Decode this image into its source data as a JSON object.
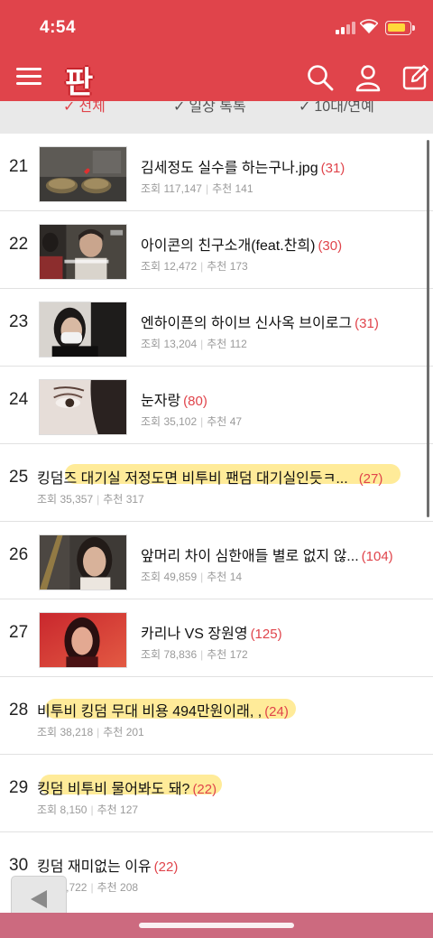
{
  "status_bar": {
    "time": "4:54"
  },
  "app_bar": {
    "logo": "판"
  },
  "filters": [
    {
      "label": "전체",
      "active": true
    },
    {
      "label": "일상 톡톡",
      "active": false
    },
    {
      "label": "10대/연예",
      "active": false
    }
  ],
  "labels": {
    "views": "조회",
    "likes": "추천"
  },
  "posts": [
    {
      "rank": "21",
      "title": "김세정도 실수를 하는구나.jpg",
      "comments": "(31)",
      "views": "117,147",
      "likes": "141"
    },
    {
      "rank": "22",
      "title": "아이콘의 친구소개(feat.찬희)",
      "comments": "(30)",
      "views": "12,472",
      "likes": "173"
    },
    {
      "rank": "23",
      "title": "엔하이픈의 하이브 신사옥 브이로그",
      "comments": "(31)",
      "views": "13,204",
      "likes": "112"
    },
    {
      "rank": "24",
      "title": "눈자랑",
      "comments": "(80)",
      "views": "35,102",
      "likes": "47"
    },
    {
      "rank": "25",
      "title": "킹덤즈 대기실 저정도면 비투비 팬덤 대기실인듯ㅋ...",
      "comments": "(27)",
      "views": "35,357",
      "likes": "317"
    },
    {
      "rank": "26",
      "title": "앞머리 차이 심한애들 별로 없지 않...",
      "comments": "(104)",
      "views": "49,859",
      "likes": "14"
    },
    {
      "rank": "27",
      "title": "카리나 VS 장원영",
      "comments": "(125)",
      "views": "78,836",
      "likes": "172"
    },
    {
      "rank": "28",
      "title": "비투비 킹덤 무대 비용 494만원이래, ,",
      "comments": "(24)",
      "views": "38,218",
      "likes": "201"
    },
    {
      "rank": "29",
      "title": "킹덤 비투비 물어봐도 돼?",
      "comments": "(22)",
      "views": "8,150",
      "likes": "127"
    },
    {
      "rank": "30",
      "title": "킹덤 재미없는 이유",
      "comments": "(22)",
      "views": "4,722",
      "likes": "208"
    }
  ]
}
